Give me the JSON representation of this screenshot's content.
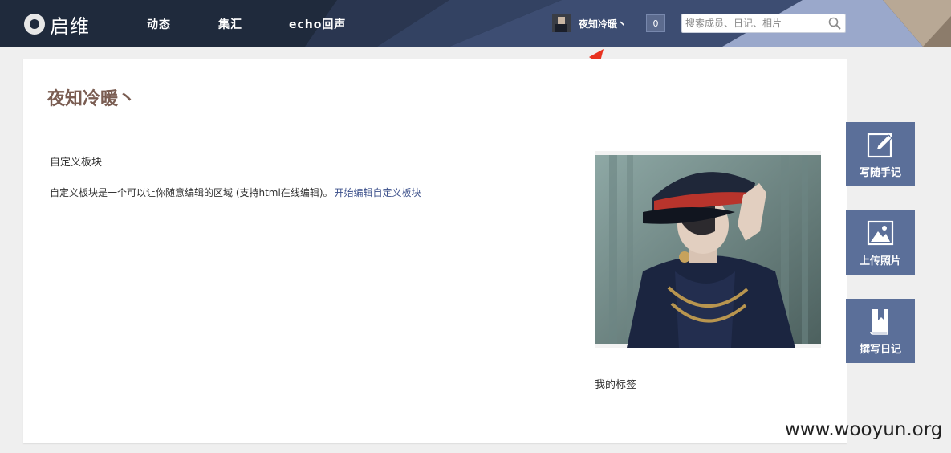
{
  "header": {
    "logo_text": "启维",
    "nav": [
      "动态",
      "集汇",
      "echo回声"
    ],
    "username": "夜知冷暖丶",
    "notification_count": "0",
    "search_placeholder": "搜索成员、日记、相片"
  },
  "main": {
    "page_title": "夜知冷暖丶",
    "custom_block": {
      "heading": "自定义板块",
      "description": "自定义板块是一个可以让你随意编辑的区域 (支持html在线编辑)。",
      "edit_link": "开始编辑自定义板块"
    },
    "tags_heading": "我的标签"
  },
  "side_actions": [
    {
      "label": "写随手记",
      "icon": "pencil-note-icon"
    },
    {
      "label": "上传照片",
      "icon": "picture-icon"
    },
    {
      "label": "撰写日记",
      "icon": "book-icon"
    }
  ],
  "watermark": "www.wooyun.org",
  "colors": {
    "nav_bg": "#1f2a3c",
    "accent": "#5b6f99",
    "title": "#7a5d52",
    "link": "#3b4f8a",
    "arrow": "#e8321f"
  }
}
